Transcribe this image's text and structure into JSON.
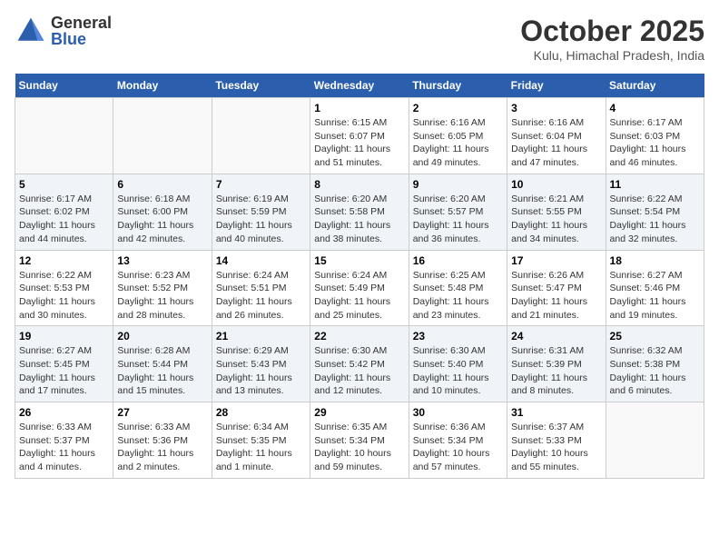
{
  "header": {
    "logo_general": "General",
    "logo_blue": "Blue",
    "month_year": "October 2025",
    "location": "Kulu, Himachal Pradesh, India"
  },
  "days_of_week": [
    "Sunday",
    "Monday",
    "Tuesday",
    "Wednesday",
    "Thursday",
    "Friday",
    "Saturday"
  ],
  "weeks": [
    [
      {
        "day": "",
        "info": ""
      },
      {
        "day": "",
        "info": ""
      },
      {
        "day": "",
        "info": ""
      },
      {
        "day": "1",
        "info": "Sunrise: 6:15 AM\nSunset: 6:07 PM\nDaylight: 11 hours\nand 51 minutes."
      },
      {
        "day": "2",
        "info": "Sunrise: 6:16 AM\nSunset: 6:05 PM\nDaylight: 11 hours\nand 49 minutes."
      },
      {
        "day": "3",
        "info": "Sunrise: 6:16 AM\nSunset: 6:04 PM\nDaylight: 11 hours\nand 47 minutes."
      },
      {
        "day": "4",
        "info": "Sunrise: 6:17 AM\nSunset: 6:03 PM\nDaylight: 11 hours\nand 46 minutes."
      }
    ],
    [
      {
        "day": "5",
        "info": "Sunrise: 6:17 AM\nSunset: 6:02 PM\nDaylight: 11 hours\nand 44 minutes."
      },
      {
        "day": "6",
        "info": "Sunrise: 6:18 AM\nSunset: 6:00 PM\nDaylight: 11 hours\nand 42 minutes."
      },
      {
        "day": "7",
        "info": "Sunrise: 6:19 AM\nSunset: 5:59 PM\nDaylight: 11 hours\nand 40 minutes."
      },
      {
        "day": "8",
        "info": "Sunrise: 6:20 AM\nSunset: 5:58 PM\nDaylight: 11 hours\nand 38 minutes."
      },
      {
        "day": "9",
        "info": "Sunrise: 6:20 AM\nSunset: 5:57 PM\nDaylight: 11 hours\nand 36 minutes."
      },
      {
        "day": "10",
        "info": "Sunrise: 6:21 AM\nSunset: 5:55 PM\nDaylight: 11 hours\nand 34 minutes."
      },
      {
        "day": "11",
        "info": "Sunrise: 6:22 AM\nSunset: 5:54 PM\nDaylight: 11 hours\nand 32 minutes."
      }
    ],
    [
      {
        "day": "12",
        "info": "Sunrise: 6:22 AM\nSunset: 5:53 PM\nDaylight: 11 hours\nand 30 minutes."
      },
      {
        "day": "13",
        "info": "Sunrise: 6:23 AM\nSunset: 5:52 PM\nDaylight: 11 hours\nand 28 minutes."
      },
      {
        "day": "14",
        "info": "Sunrise: 6:24 AM\nSunset: 5:51 PM\nDaylight: 11 hours\nand 26 minutes."
      },
      {
        "day": "15",
        "info": "Sunrise: 6:24 AM\nSunset: 5:49 PM\nDaylight: 11 hours\nand 25 minutes."
      },
      {
        "day": "16",
        "info": "Sunrise: 6:25 AM\nSunset: 5:48 PM\nDaylight: 11 hours\nand 23 minutes."
      },
      {
        "day": "17",
        "info": "Sunrise: 6:26 AM\nSunset: 5:47 PM\nDaylight: 11 hours\nand 21 minutes."
      },
      {
        "day": "18",
        "info": "Sunrise: 6:27 AM\nSunset: 5:46 PM\nDaylight: 11 hours\nand 19 minutes."
      }
    ],
    [
      {
        "day": "19",
        "info": "Sunrise: 6:27 AM\nSunset: 5:45 PM\nDaylight: 11 hours\nand 17 minutes."
      },
      {
        "day": "20",
        "info": "Sunrise: 6:28 AM\nSunset: 5:44 PM\nDaylight: 11 hours\nand 15 minutes."
      },
      {
        "day": "21",
        "info": "Sunrise: 6:29 AM\nSunset: 5:43 PM\nDaylight: 11 hours\nand 13 minutes."
      },
      {
        "day": "22",
        "info": "Sunrise: 6:30 AM\nSunset: 5:42 PM\nDaylight: 11 hours\nand 12 minutes."
      },
      {
        "day": "23",
        "info": "Sunrise: 6:30 AM\nSunset: 5:40 PM\nDaylight: 11 hours\nand 10 minutes."
      },
      {
        "day": "24",
        "info": "Sunrise: 6:31 AM\nSunset: 5:39 PM\nDaylight: 11 hours\nand 8 minutes."
      },
      {
        "day": "25",
        "info": "Sunrise: 6:32 AM\nSunset: 5:38 PM\nDaylight: 11 hours\nand 6 minutes."
      }
    ],
    [
      {
        "day": "26",
        "info": "Sunrise: 6:33 AM\nSunset: 5:37 PM\nDaylight: 11 hours\nand 4 minutes."
      },
      {
        "day": "27",
        "info": "Sunrise: 6:33 AM\nSunset: 5:36 PM\nDaylight: 11 hours\nand 2 minutes."
      },
      {
        "day": "28",
        "info": "Sunrise: 6:34 AM\nSunset: 5:35 PM\nDaylight: 11 hours\nand 1 minute."
      },
      {
        "day": "29",
        "info": "Sunrise: 6:35 AM\nSunset: 5:34 PM\nDaylight: 10 hours\nand 59 minutes."
      },
      {
        "day": "30",
        "info": "Sunrise: 6:36 AM\nSunset: 5:34 PM\nDaylight: 10 hours\nand 57 minutes."
      },
      {
        "day": "31",
        "info": "Sunrise: 6:37 AM\nSunset: 5:33 PM\nDaylight: 10 hours\nand 55 minutes."
      },
      {
        "day": "",
        "info": ""
      }
    ]
  ]
}
